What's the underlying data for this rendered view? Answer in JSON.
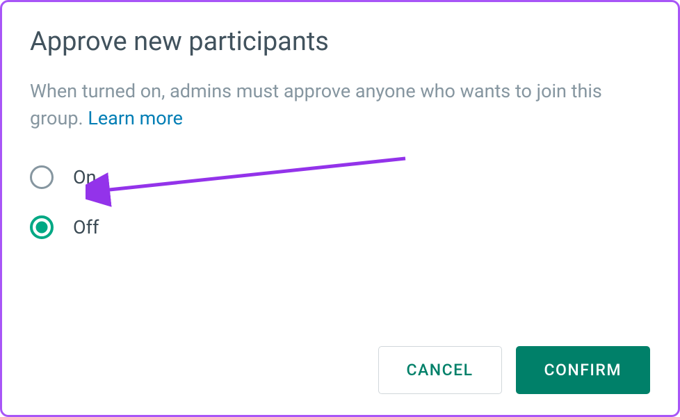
{
  "dialog": {
    "heading": "Approve new participants",
    "description": "When turned on, admins must approve anyone who wants to join this group. ",
    "learn_more": "Learn more",
    "options": {
      "on": "On",
      "off": "Off"
    },
    "selected": "off",
    "buttons": {
      "cancel": "CANCEL",
      "confirm": "CONFIRM"
    }
  },
  "colors": {
    "border": "#a855f7",
    "heading": "#41525d",
    "description": "#8696a0",
    "link": "#027eb5",
    "accent": "#00a884",
    "accent_dark": "#008069",
    "arrow": "#9333ea"
  }
}
